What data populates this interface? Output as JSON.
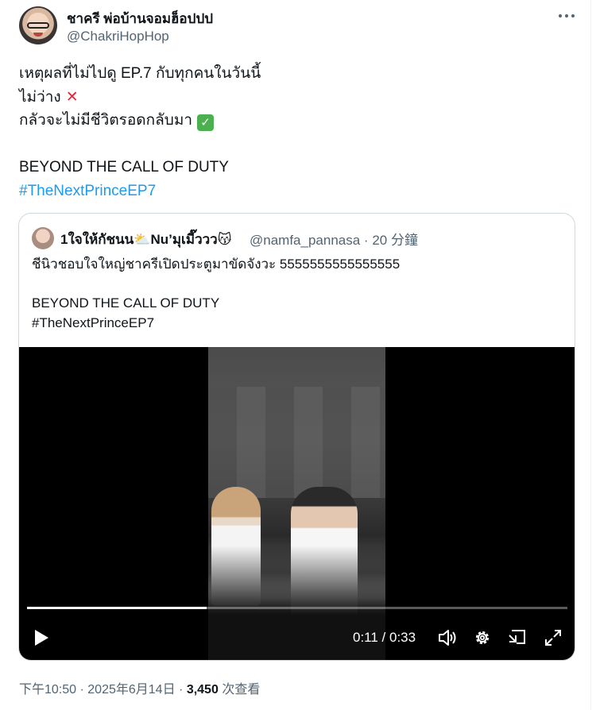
{
  "author": {
    "display_name": "ชาครี พ่อบ้านจอมฮ็อปปป",
    "handle": "@ChakriHopHop"
  },
  "tweet": {
    "lines": [
      "เหตุผลที่ไม่ไปดู EP.7 กับทุกคนในวันนี้",
      "ไม่ว่าง",
      "กลัวจะไม่มีชีวิตรอดกลับมา",
      "",
      "BEYOND THE CALL OF DUTY"
    ],
    "hashtag": "#TheNextPrinceEP7",
    "x_emoji": "✕",
    "check_emoji": "✓"
  },
  "quote": {
    "display_name": "1ใจให้กัชนน⛅Nu’มุเมี๊ววว😽",
    "handle": "@namfa_pannasa",
    "time": "20 分鐘",
    "lines": [
      "ชีนิวชอบใจใหญ่ชาครีเปิดประตูมาขัดจังวะ 5555555555555555",
      "",
      "BEYOND THE CALL OF DUTY",
      "#TheNextPrinceEP7"
    ]
  },
  "video": {
    "current_time": "0:11",
    "duration": "0:33",
    "time_display": "0:11 / 0:33",
    "progress": 0.333
  },
  "footer": {
    "time": "下午10:50",
    "date": "2025年6月14日",
    "views": "3,450",
    "views_label": "次查看"
  },
  "colors": {
    "link": "#1d9bf0",
    "secondary_text": "#536471",
    "border": "#cfd9de"
  }
}
